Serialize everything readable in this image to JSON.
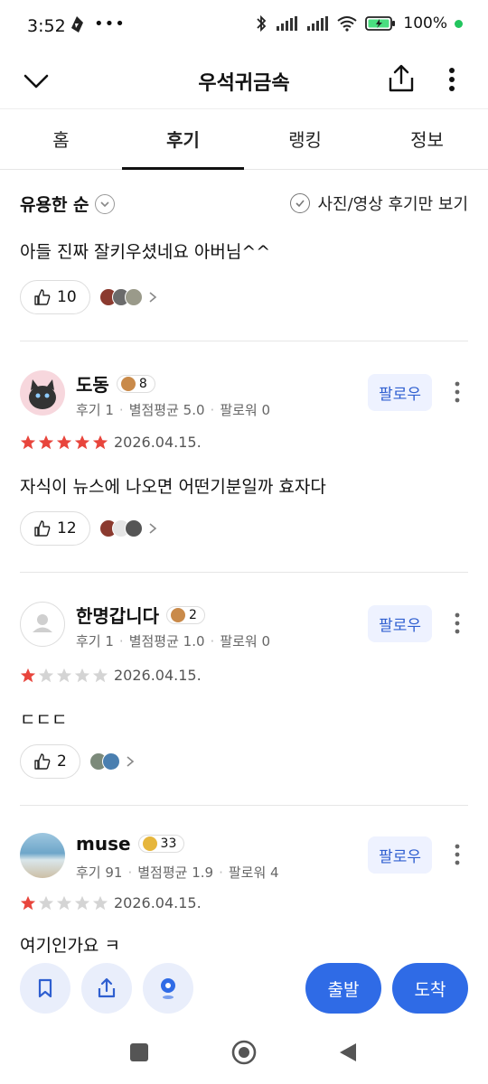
{
  "status": {
    "time": "3:52",
    "battery": "100%"
  },
  "header": {
    "title": "우석귀금속"
  },
  "tabs": [
    {
      "label": "홈"
    },
    {
      "label": "후기"
    },
    {
      "label": "랭킹"
    },
    {
      "label": "정보"
    }
  ],
  "sort": {
    "label": "유용한 순",
    "photo_only_label": "사진/영상 후기만 보기"
  },
  "first_review": {
    "text": "아들 진짜 잘키우셨네요 아버님^^",
    "likes": "10"
  },
  "reviews": [
    {
      "name": "도동",
      "level": "8",
      "reviews_label": "후기 1",
      "avg_label": "별점평균 5.0",
      "followers_label": "팔로워 0",
      "rating": 5,
      "date": "2026.04.15.",
      "text": "자식이 뉴스에 나오면 어떤기분일까 효자다",
      "likes": "12",
      "follow_label": "팔로우"
    },
    {
      "name": "한명갑니다",
      "level": "2",
      "reviews_label": "후기 1",
      "avg_label": "별점평균 1.0",
      "followers_label": "팔로워 0",
      "rating": 1,
      "date": "2026.04.15.",
      "text": "ㄷㄷㄷ",
      "likes": "2",
      "follow_label": "팔로우"
    },
    {
      "name": "muse",
      "level": "33",
      "reviews_label": "후기 91",
      "avg_label": "별점평균 1.9",
      "followers_label": "팔로워 4",
      "rating": 1,
      "date": "2026.04.15.",
      "text": "여기인가요 ㅋ",
      "follow_label": "팔로우"
    }
  ],
  "actions": {
    "depart_label": "출발",
    "arrive_label": "도착"
  },
  "colors": {
    "accent": "#2f6be6",
    "star": "#e8453c",
    "follow_text": "#2f5fd0"
  }
}
